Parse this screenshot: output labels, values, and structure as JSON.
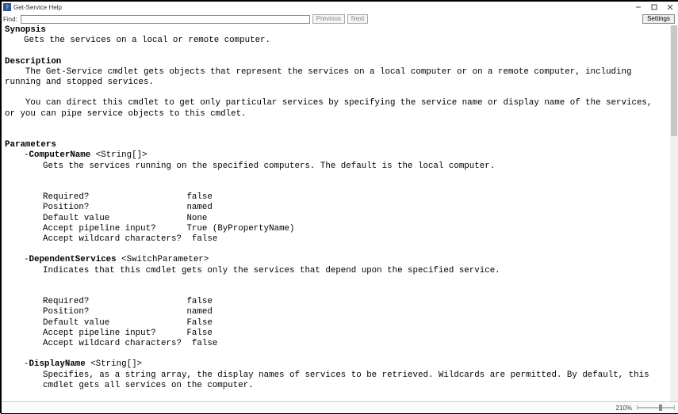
{
  "window": {
    "title": "Get-Service Help",
    "min_tooltip": "Minimize",
    "max_tooltip": "Maximize",
    "close_tooltip": "Close"
  },
  "find": {
    "label": "Find:",
    "value": "",
    "placeholder": "",
    "prev": "Previous",
    "next": "Next",
    "settings": "Settings"
  },
  "status": {
    "zoom": "210%"
  },
  "doc": {
    "synopsis_head": "Synopsis",
    "synopsis_text": "Gets the services on a local or remote computer.",
    "description_head": "Description",
    "description_p1": "The Get-Service cmdlet gets objects that represent the services on a local computer or on a remote computer, including running and stopped services.",
    "description_p2": "You can direct this cmdlet to get only particular services by specifying the service name or display name of the services, or you can pipe service objects to this cmdlet.",
    "parameters_head": "Parameters",
    "attr_labels": {
      "required": "Required?",
      "position": "Position?",
      "default": "Default value",
      "pipeline": "Accept pipeline input?",
      "wildcard": "Accept wildcard characters?"
    },
    "params": [
      {
        "dash": "-",
        "name": "ComputerName",
        "type": " <String[]>",
        "desc": "Gets the services running on the specified computers. The default is the local computer.",
        "attrs": {
          "required": "false",
          "position": "named",
          "default": "None",
          "pipeline": "True (ByPropertyName)",
          "wildcard": "false"
        }
      },
      {
        "dash": "-",
        "name": "DependentServices",
        "type": " <SwitchParameter>",
        "desc": "Indicates that this cmdlet gets only the services that depend upon the specified service.",
        "attrs": {
          "required": "false",
          "position": "named",
          "default": "False",
          "pipeline": "False",
          "wildcard": "false"
        }
      },
      {
        "dash": "-",
        "name": "DisplayName",
        "type": " <String[]>",
        "desc": "Specifies, as a string array, the display names of services to be retrieved. Wildcards are permitted. By default, this cmdlet gets all services on the computer.",
        "attrs": null
      }
    ]
  }
}
